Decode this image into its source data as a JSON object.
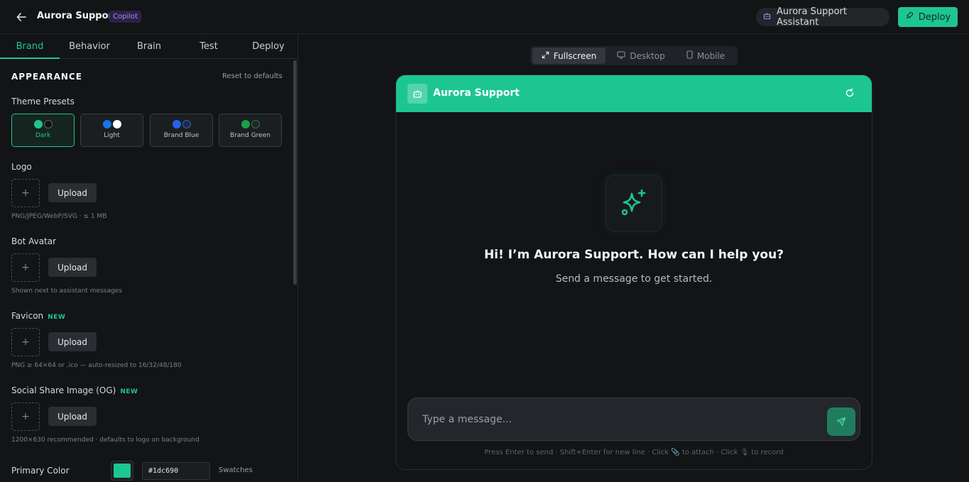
{
  "header": {
    "title": "Aurora Support",
    "badge": "Copilot",
    "assistant_label": "Aurora Support Assistant",
    "deploy_label": "Deploy"
  },
  "tabs": [
    {
      "label": "Brand",
      "active": true
    },
    {
      "label": "Behavior",
      "active": false
    },
    {
      "label": "Brain",
      "active": false
    },
    {
      "label": "Test",
      "active": false
    },
    {
      "label": "Deploy",
      "active": false
    }
  ],
  "appearance": {
    "title": "APPEARANCE",
    "reset_label": "Reset to defaults",
    "presets_label": "Theme Presets",
    "presets": [
      {
        "name": "Dark",
        "colors": [
          "#1dc690",
          "#111111"
        ],
        "active": true
      },
      {
        "name": "Light",
        "colors": [
          "#1a73e8",
          "#ffffff"
        ],
        "active": false
      },
      {
        "name": "Brand Blue",
        "colors": [
          "#2563eb",
          "#1e2a4a"
        ],
        "active": false
      },
      {
        "name": "Brand Green",
        "colors": [
          "#16a34a",
          "#1a2a1f"
        ],
        "active": false
      }
    ],
    "logo": {
      "label": "Logo",
      "upload": "Upload",
      "hint": "PNG/JPEG/WebP/SVG · ≤ 1 MB",
      "plus": "+"
    },
    "bot_avatar": {
      "label": "Bot Avatar",
      "upload": "Upload",
      "hint": "Shown next to assistant messages",
      "plus": "+"
    },
    "favicon": {
      "label": "Favicon",
      "tag": "NEW",
      "upload": "Upload",
      "hint": "PNG ≥ 64×64 or .ico — auto-resized to 16/32/48/180",
      "plus": "+"
    },
    "og_image": {
      "label": "Social Share Image (OG)",
      "tag": "NEW",
      "upload": "Upload",
      "hint": "1200×630 recommended · defaults to logo on background",
      "plus": "+"
    },
    "primary_color": {
      "label": "Primary Color",
      "value": "#1dc690",
      "swatches_label": "Swatches"
    }
  },
  "preview": {
    "views": [
      {
        "label": "Fullscreen",
        "icon": "expand-icon",
        "active": true
      },
      {
        "label": "Desktop",
        "icon": "monitor-icon",
        "active": false
      },
      {
        "label": "Mobile",
        "icon": "phone-icon",
        "active": false
      }
    ],
    "chat": {
      "title": "Aurora Support",
      "greeting": "Hi! I’m Aurora Support. How can I help you?",
      "subtext": "Send a message to get started.",
      "placeholder": "Type a message...",
      "hint": "Press Enter to send · Shift+Enter for new line · Click 📎 to attach · Click 🎙 to record"
    }
  },
  "colors": {
    "accent": "#1dc690",
    "background": "#121416"
  }
}
